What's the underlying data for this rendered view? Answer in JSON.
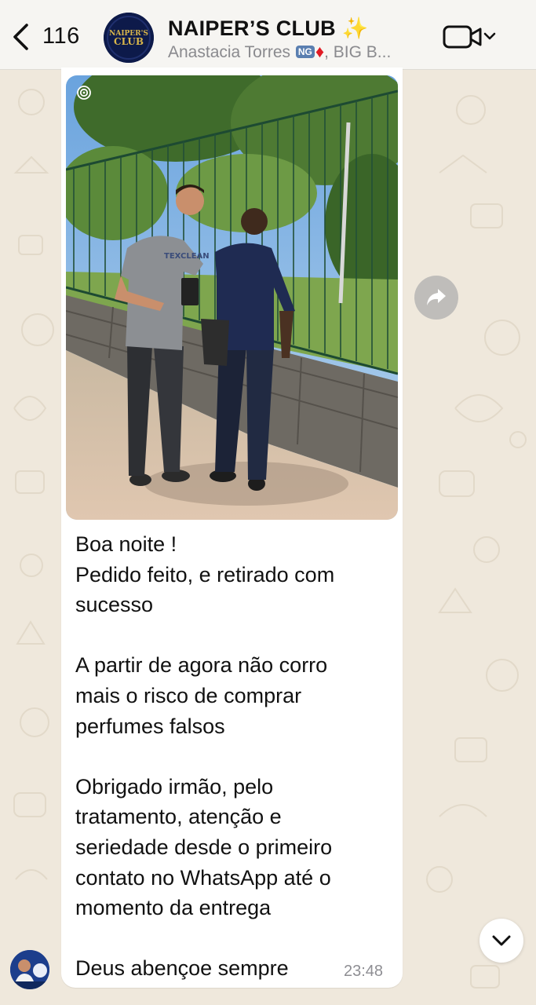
{
  "header": {
    "back_count": "116",
    "title": "NAIPER’S CLUB",
    "title_emoji": "✨",
    "subtitle_first_member": "Anastacia Torres",
    "subtitle_badge": "NG",
    "subtitle_rest": ", BIG B...",
    "avatar_logo_line1": "NAIPER'S",
    "avatar_logo_line2": "CLUB"
  },
  "message": {
    "paragraphs": [
      [
        "Boa noite !",
        "Pedido feito, e retirado com",
        "sucesso"
      ],
      [
        "A partir de agora não corro",
        "mais o risco de comprar",
        "perfumes falsos"
      ],
      [
        "Obrigado irmão, pelo",
        "tratamento, atenção e",
        "seriedade desde o primeiro",
        "contato no WhatsApp até o",
        "momento da entrega"
      ],
      [
        "Deus abençoe sempre"
      ]
    ],
    "time": "23:48"
  },
  "photo": {
    "shirt_print": "TEXCLEAN"
  },
  "colors": {
    "header_bg": "#f6f5f2",
    "chat_bg": "#efe8dc",
    "bubble_bg": "#ffffff",
    "icon": "#111111",
    "muted_text": "#8a8a8e"
  }
}
